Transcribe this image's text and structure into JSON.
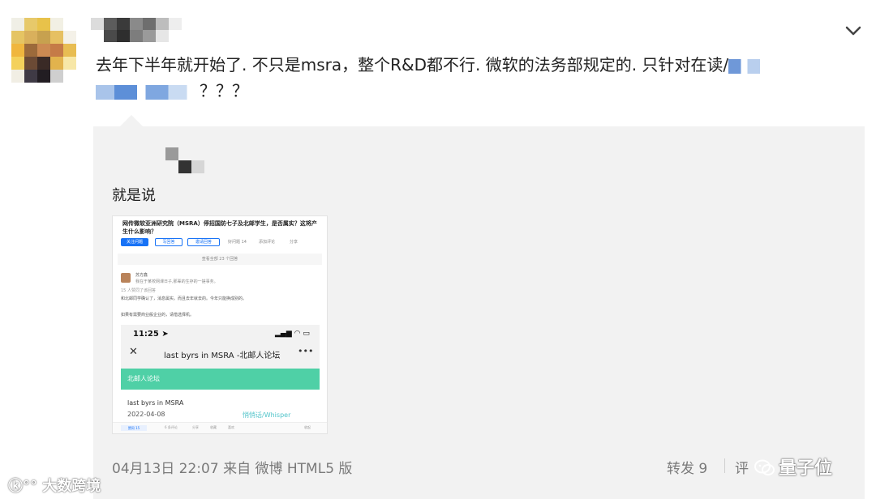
{
  "post": {
    "text_line1": "去年下半年就开始了. 不只是msra，整个R&D都不行. 微软的法务部规定的. 只针对在读/",
    "text_line2_suffix": "？？？",
    "avatar_icon": "pixelated-avatar-icon",
    "expand_icon": "chevron-down-icon"
  },
  "repost": {
    "text": "就是说",
    "screenshot": {
      "question_title": "网传微软亚洲研究院（MSRA）停招国防七子及北邮学生，是否属实？这将产生什么影响？",
      "follow_btn": "关注问题",
      "answer_btn": "写回答",
      "invite_btn": "邀请回答",
      "comments_meta": "好问题 14",
      "add_comment": "添加评论",
      "share": "分享",
      "view_all": "查看全部 23 个回答",
      "answerer_name": "苏方鑫",
      "answerer_bio": "我在于某校网课日子,那辈的生存的一搓事务。",
      "upvote_note": "15 人赞同了该回答",
      "answer_line1": "和北邮同学确认了，消息属实。而且去年就去的。今年只能换成别的。",
      "answer_line2": "如果有需要商业般企业的，请借选择机。",
      "phone": {
        "time": "11:25",
        "nav_title": "last byrs in MSRA -北邮人论坛",
        "forum_name": "北邮人论坛",
        "post_title": "last byrs in MSRA",
        "post_date": "2022-04-08",
        "board": "悄悄话/Whisper"
      },
      "footer": {
        "agree": "赞同 15",
        "comments": "6 条评论",
        "share": "分享",
        "favorite": "收藏",
        "like": "喜欢",
        "collapse": "收起"
      }
    }
  },
  "meta": {
    "timestamp": "04月13日 22:07",
    "source": "来自 微博 HTML5 版",
    "repost_count": "转发 9",
    "comment_partial": "评"
  },
  "watermarks": {
    "left": "大数跨境",
    "right": "量子位"
  },
  "colors": {
    "mosaic": [
      "#f0efe6",
      "#e7c96a",
      "#e8c24a",
      "#f2f0e4",
      "#ffffff",
      "#e5c463",
      "#d9b05c",
      "#c7a14f",
      "#e6c062",
      "#f4f1e8",
      "#f0b63e",
      "#9c6a3b",
      "#cc8a52",
      "#c57b47",
      "#e8bd52",
      "#f4d15b",
      "#6b4a35",
      "#3a2a26",
      "#e2b34d",
      "#f7e7a7",
      "#f1eee4",
      "#3f3a45",
      "#221d22",
      "#cfcfcf",
      "#ffffff"
    ],
    "username_mosaic": [
      "#dcdcdc",
      "#5c5c5c",
      "#3a3a3a",
      "#8a8a8a",
      "#6e6e6e",
      "#bdbdbd",
      "#eeeeee",
      "#ffffff",
      "#4a4a4a",
      "#2e2e2e",
      "#7d7d7d",
      "#9a9a9a",
      "#e6e6e6",
      "#ffffff"
    ],
    "repost_user_mosaic": [
      "#f2f2f2",
      "#9a9a9a",
      "#f2f2f2",
      "#f2f2f2",
      "#f2f2f2",
      "#f2f2f2",
      "#f2f2f2",
      "#333333",
      "#d6d6d6",
      "#f2f2f2"
    ],
    "text_blur": [
      "#7fa7e0",
      "#4f86d6",
      "#b8d0f0",
      "#5d8fd8",
      "#a8c3ea",
      "#ffffff",
      "#6c9ade",
      "#c7daf3"
    ]
  }
}
